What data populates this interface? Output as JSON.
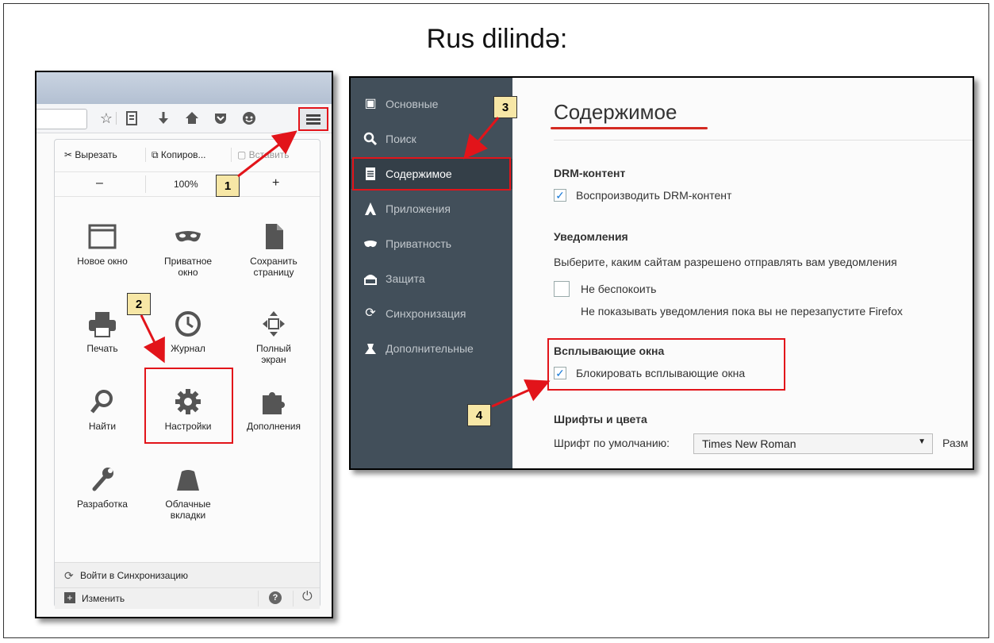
{
  "page": {
    "title": "Rus dilində:"
  },
  "menu": {
    "edit": {
      "cut": "Вырезать",
      "copy": "Копиров...",
      "paste": "Вставить"
    },
    "zoom": {
      "minus": "–",
      "value": "100%",
      "plus": "+"
    },
    "items": [
      {
        "id": "new-window",
        "label": "Новое окно",
        "icon": "window-icon"
      },
      {
        "id": "private-window",
        "label": "Приватное окно",
        "icon": "mask-icon"
      },
      {
        "id": "save-page",
        "label": "Сохранить страницу",
        "icon": "page-icon"
      },
      {
        "id": "print",
        "label": "Печать",
        "icon": "printer-icon"
      },
      {
        "id": "history",
        "label": "Журнал",
        "icon": "clock-icon"
      },
      {
        "id": "fullscreen",
        "label": "Полный экран",
        "icon": "fullscreen-icon"
      },
      {
        "id": "find",
        "label": "Найти",
        "icon": "magnifier-icon"
      },
      {
        "id": "settings",
        "label": "Настройки",
        "icon": "gear-icon"
      },
      {
        "id": "addons",
        "label": "Дополнения",
        "icon": "puzzle-icon"
      },
      {
        "id": "developer",
        "label": "Разработка",
        "icon": "wrench-icon"
      },
      {
        "id": "cloud-tabs",
        "label": "Облачные вкладки",
        "icon": "cloud-tabs-icon"
      }
    ],
    "sync": "Войти в Синхронизацию",
    "customize": "Изменить"
  },
  "callouts": {
    "n1": "1",
    "n2": "2",
    "n3": "3",
    "n4": "4"
  },
  "options": {
    "sidebar": [
      {
        "label": "Основные",
        "icon": "general-icon"
      },
      {
        "label": "Поиск",
        "icon": "search-icon"
      },
      {
        "label": "Содержимое",
        "icon": "content-icon",
        "active": true
      },
      {
        "label": "Приложения",
        "icon": "applications-icon"
      },
      {
        "label": "Приватность",
        "icon": "privacy-icon"
      },
      {
        "label": "Защита",
        "icon": "security-icon"
      },
      {
        "label": "Синхронизация",
        "icon": "sync-icon"
      },
      {
        "label": "Дополнительные",
        "icon": "advanced-icon"
      }
    ],
    "heading": "Содержимое",
    "drm": {
      "title": "DRM-контент",
      "checkbox": "Воспроизводить DRM-контент",
      "checked": true
    },
    "notifications": {
      "title": "Уведомления",
      "desc": "Выберите, каким сайтам разрешено отправлять вам уведомления",
      "checkbox": "Не беспокоить",
      "checked": false,
      "note": "Не показывать уведомления пока вы не перезапустите Firefox"
    },
    "popups": {
      "title": "Всплывающие окна",
      "checkbox": "Блокировать всплывающие окна",
      "checked": true
    },
    "fonts": {
      "title": "Шрифты и цвета",
      "default_label": "Шрифт по умолчанию:",
      "default_value": "Times New Roman",
      "size_label": "Разм"
    }
  },
  "colors": {
    "callout_red": "#e2141a",
    "callout_fill": "#f7e7a6",
    "sidebar_bg": "#424f5a",
    "check_blue": "#1a7bd8"
  }
}
